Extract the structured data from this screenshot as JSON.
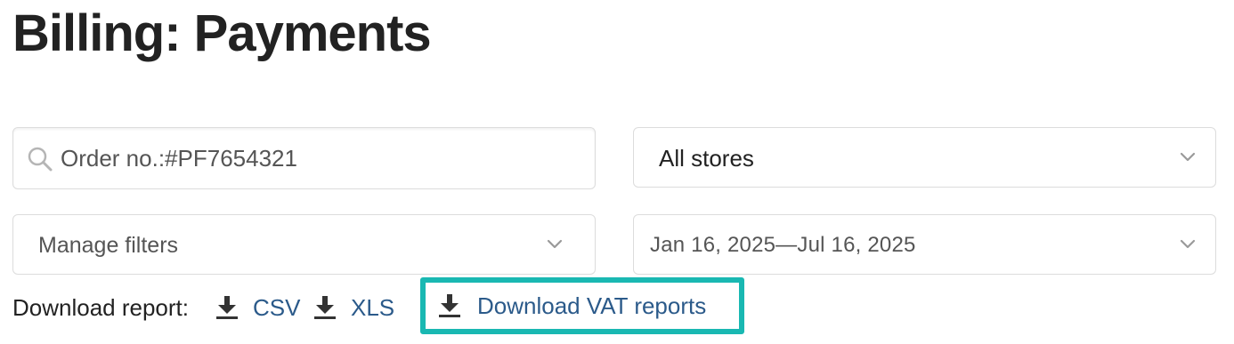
{
  "page": {
    "title": "Billing: Payments"
  },
  "filters": {
    "search": {
      "value": "Order no.:#PF7654321",
      "icon": "search-icon"
    },
    "store_select": {
      "value": "All stores",
      "icon": "chevron-down-icon"
    },
    "manage_filters": {
      "value": "Manage filters",
      "icon": "chevron-down-icon"
    },
    "date_range": {
      "value": "Jan 16, 2025—Jul 16, 2025",
      "icon": "chevron-down-icon"
    }
  },
  "download": {
    "label": "Download report:",
    "csv_label": "CSV",
    "xls_label": "XLS",
    "vat_label": "Download VAT reports",
    "icon": "download-icon"
  },
  "colors": {
    "link": "#2b5a8a",
    "highlight": "#19b8b2",
    "text": "#222222",
    "border": "#dcdcdc"
  }
}
